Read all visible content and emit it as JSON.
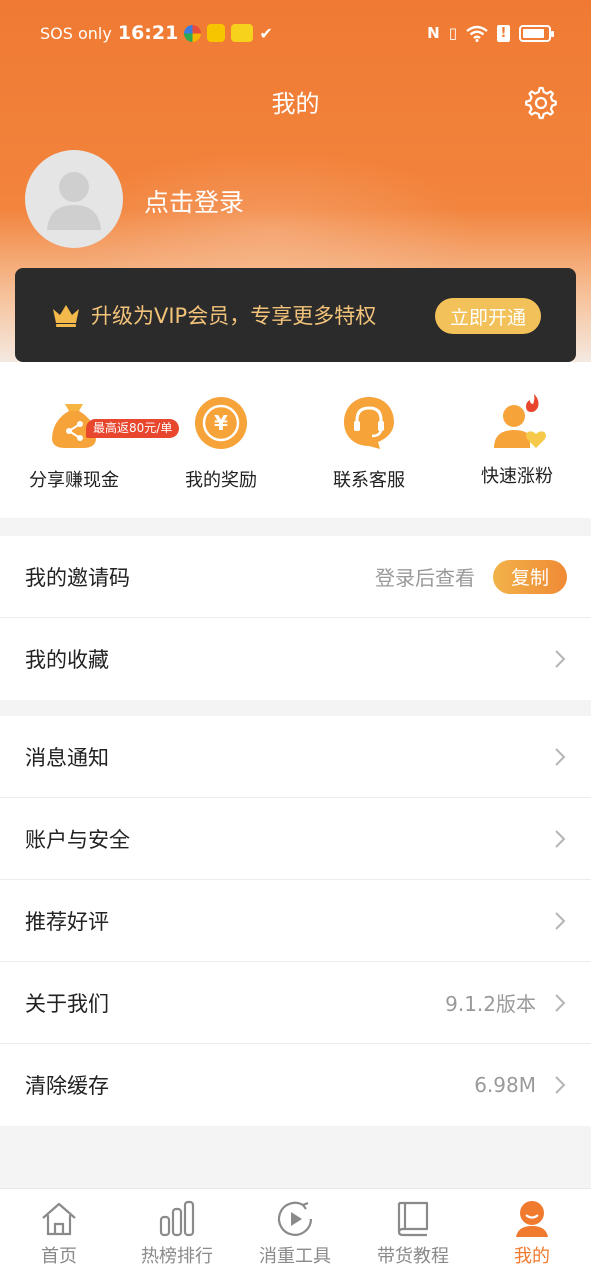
{
  "status_bar": {
    "carrier": "SOS only",
    "time": "16:21"
  },
  "header": {
    "title": "我的",
    "settings_icon": "gear-icon"
  },
  "profile": {
    "login_text": "点击登录"
  },
  "vip": {
    "text": "升级为VIP会员，专享更多特权",
    "button": "立即开通"
  },
  "quick_actions": [
    {
      "label": "分享赚现金",
      "icon": "money-bag-share-icon",
      "badge": "最高返80元/单"
    },
    {
      "label": "我的奖励",
      "icon": "yuan-reward-icon"
    },
    {
      "label": "联系客服",
      "icon": "headset-icon"
    },
    {
      "label": "快速涨粉",
      "icon": "fans-fire-icon"
    }
  ],
  "section1": [
    {
      "label": "我的邀请码",
      "value": "登录后查看",
      "button": "复制"
    },
    {
      "label": "我的收藏"
    }
  ],
  "section2": [
    {
      "label": "消息通知"
    },
    {
      "label": "账户与安全"
    },
    {
      "label": "推荐好评"
    },
    {
      "label": "关于我们",
      "value": "9.1.2版本"
    },
    {
      "label": "清除缓存",
      "value": "6.98M"
    }
  ],
  "tabs": [
    {
      "label": "首页",
      "icon": "home-icon"
    },
    {
      "label": "热榜排行",
      "icon": "bar-chart-icon"
    },
    {
      "label": "消重工具",
      "icon": "play-circle-icon"
    },
    {
      "label": "带货教程",
      "icon": "book-icon"
    },
    {
      "label": "我的",
      "icon": "profile-face-icon",
      "active": true
    }
  ],
  "colors": {
    "accent": "#f07a2e",
    "vip_gold": "#f3c37a",
    "vip_bg": "#2b2b2b"
  }
}
